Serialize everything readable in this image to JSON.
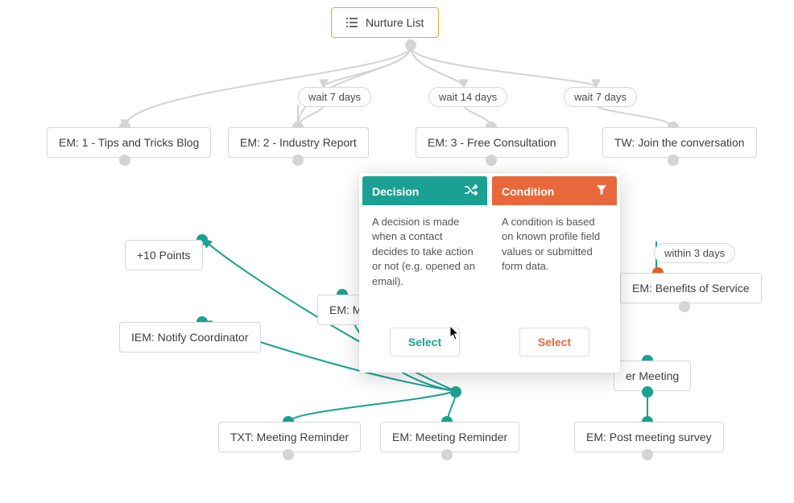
{
  "root": {
    "label": "Nurture List"
  },
  "waits": {
    "w1": "wait 7 days",
    "w2": "wait 14 days",
    "w3": "wait 7 days",
    "w4": "within 3 days"
  },
  "nodes": {
    "em1": "EM: 1 - Tips and Tricks Blog",
    "em2": "EM: 2 - Industry Report",
    "em3": "EM: 3 - Free Consultation",
    "tw": "TW: Join the conversation",
    "pts": "+10 Points",
    "iem": "IEM: Notify Coordinator",
    "emMe": "EM: Me",
    "benefits": "EM: Benefits of Service",
    "meeting": "er Meeting",
    "txtRem": "TXT: Meeting Reminder",
    "emRem": "EM: Meeting Reminder",
    "survey": "EM: Post meeting survey"
  },
  "popup": {
    "decision": {
      "title": "Decision",
      "body": "A decision is made when a contact decides to take action or not (e.g. opened an email).",
      "select": "Select"
    },
    "condition": {
      "title": "Condition",
      "body": "A condition is based on known profile field values or submitted form data.",
      "select": "Select"
    }
  }
}
